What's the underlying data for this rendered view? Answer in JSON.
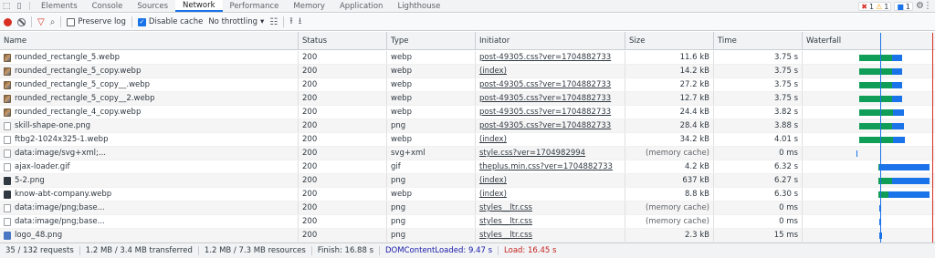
{
  "tabs": [
    "Elements",
    "Console",
    "Sources",
    "Network",
    "Performance",
    "Memory",
    "Application",
    "Lighthouse"
  ],
  "active_tab": "Network",
  "badges": {
    "errors": "1",
    "warnings": "1",
    "info": "1"
  },
  "toolbar": {
    "preserve_log": "Preserve log",
    "disable_cache": "Disable cache",
    "throttling": "No throttling"
  },
  "columns": [
    "Name",
    "Status",
    "Type",
    "Initiator",
    "Size",
    "Time",
    "Waterfall"
  ],
  "rows": [
    {
      "name": "rounded_rectangle_5.webp",
      "status": "200",
      "type": "webp",
      "initiator": "post-49305.css?ver=1704882733",
      "size": "11.6 kB",
      "time": "3.75 s",
      "icon": "image-thumb",
      "wf": [
        0.44,
        0.7,
        0.78
      ]
    },
    {
      "name": "rounded_rectangle_5_copy.webp",
      "status": "200",
      "type": "webp",
      "initiator": "(index)",
      "size": "14.2 kB",
      "time": "3.75 s",
      "icon": "image-thumb",
      "wf": [
        0.44,
        0.7,
        0.78
      ]
    },
    {
      "name": "rounded_rectangle_5_copy__.webp",
      "status": "200",
      "type": "webp",
      "initiator": "post-49305.css?ver=1704882733",
      "size": "27.2 kB",
      "time": "3.75 s",
      "icon": "image-thumb",
      "wf": [
        0.44,
        0.7,
        0.78
      ]
    },
    {
      "name": "rounded_rectangle_5_copy__2.webp",
      "status": "200",
      "type": "webp",
      "initiator": "post-49305.css?ver=1704882733",
      "size": "12.7 kB",
      "time": "3.75 s",
      "icon": "image-thumb",
      "wf": [
        0.44,
        0.7,
        0.78
      ]
    },
    {
      "name": "rounded_rectangle_4_copy.webp",
      "status": "200",
      "type": "webp",
      "initiator": "post-49305.css?ver=1704882733",
      "size": "24.4 kB",
      "time": "3.82 s",
      "icon": "image-thumb",
      "wf": [
        0.44,
        0.71,
        0.79
      ]
    },
    {
      "name": "skill-shape-one.png",
      "status": "200",
      "type": "png",
      "initiator": "post-49305.css?ver=1704882733",
      "size": "28.4 kB",
      "time": "3.88 s",
      "icon": "file",
      "wf": [
        0.44,
        0.7,
        0.79
      ]
    },
    {
      "name": "ftbg2-1024x325-1.webp",
      "status": "200",
      "type": "webp",
      "initiator": "(index)",
      "size": "34.2 kB",
      "time": "4.01 s",
      "icon": "file",
      "wf": [
        0.44,
        0.71,
        0.8
      ]
    },
    {
      "name": "data:image/svg+xml;...",
      "status": "200",
      "type": "svg+xml",
      "initiator": "style.css?ver=1704982994",
      "size": "(memory cache)",
      "time": "0 ms",
      "icon": "file",
      "wf": [
        0.42,
        0.42,
        0.43
      ]
    },
    {
      "name": "ajax-loader.gif",
      "status": "200",
      "type": "gif",
      "initiator": "theplus.min.css?ver=1704882733",
      "size": "4.2 kB",
      "time": "6.32 s",
      "icon": "file",
      "wf": [
        0.59,
        0.6,
        0.99
      ]
    },
    {
      "name": "5-2.png",
      "status": "200",
      "type": "png",
      "initiator": "(index)",
      "size": "637 kB",
      "time": "6.27 s",
      "icon": "dark",
      "wf": [
        0.59,
        0.7,
        0.99
      ]
    },
    {
      "name": "know-abt-company.webp",
      "status": "200",
      "type": "webp",
      "initiator": "(index)",
      "size": "8.8 kB",
      "time": "6.30 s",
      "icon": "dark",
      "wf": [
        0.59,
        0.67,
        0.99
      ]
    },
    {
      "name": "data:image/png;base...",
      "status": "200",
      "type": "png",
      "initiator": "styles__ltr.css",
      "size": "(memory cache)",
      "time": "0 ms",
      "icon": "file",
      "wf": [
        0.6,
        0.6,
        0.61
      ]
    },
    {
      "name": "data:image/png;base...",
      "status": "200",
      "type": "png",
      "initiator": "styles__ltr.css",
      "size": "(memory cache)",
      "time": "0 ms",
      "icon": "file",
      "wf": [
        0.6,
        0.6,
        0.61
      ]
    },
    {
      "name": "logo_48.png",
      "status": "200",
      "type": "png",
      "initiator": "styles__ltr.css",
      "size": "2.3 kB",
      "time": "15 ms",
      "icon": "blue",
      "wf": [
        0.6,
        0.6,
        0.62
      ]
    }
  ],
  "status_bar": {
    "requests": "35 / 132 requests",
    "transferred": "1.2 MB / 3.4 MB transferred",
    "resources": "1.2 MB / 7.3 MB resources",
    "finish": "Finish: 16.88 s",
    "dcl": "DOMContentLoaded: 9.47 s",
    "load": "Load: 16.45 s"
  },
  "colors": {
    "accent": "#1a73e8",
    "record": "#d93025",
    "wait": "#0f9d58",
    "download": "#1a73e8"
  }
}
